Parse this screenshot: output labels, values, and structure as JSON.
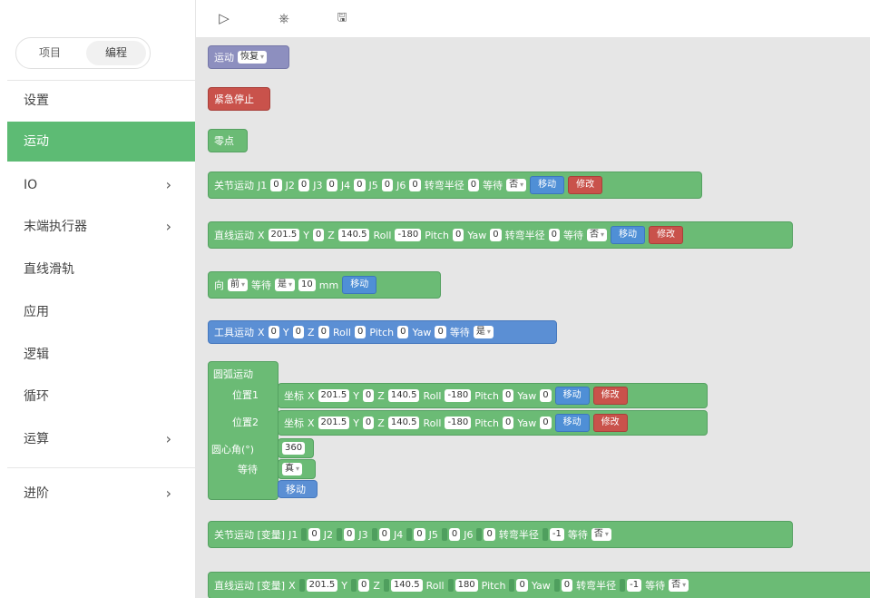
{
  "sidebar": {
    "seg": {
      "project": "项目",
      "program": "编程"
    },
    "items": [
      {
        "label": "设置"
      },
      {
        "label": "运动"
      },
      {
        "label": "IO",
        "arrow": "›"
      },
      {
        "label": "末端执行器",
        "arrow": "›"
      },
      {
        "label": "直线滑轨"
      },
      {
        "label": "应用"
      },
      {
        "label": "逻辑"
      },
      {
        "label": "循环"
      },
      {
        "label": "运算",
        "arrow": "›"
      },
      {
        "label": "进阶",
        "arrow": "›"
      }
    ]
  },
  "toolbar": {
    "run_icon": "▷",
    "debug_icon": "⎈",
    "save_icon": "🖫"
  },
  "blocks": {
    "b1": {
      "label": "运动",
      "dd": "恢复"
    },
    "b2": {
      "label": "紧急停止"
    },
    "b3": {
      "label": "零点"
    },
    "b4": {
      "label": "关节运动",
      "j1": "J1",
      "v1": "0",
      "j2": "J2",
      "v2": "0",
      "j3": "J3",
      "v3": "0",
      "j4": "J4",
      "v4": "0",
      "j5": "J5",
      "v5": "0",
      "j6": "J6",
      "v6": "0",
      "radius": "转弯半径",
      "rv": "0",
      "wait": "等待",
      "wv": "否",
      "move": "移动",
      "modify": "修改"
    },
    "b5": {
      "label": "直线运动",
      "x": "X",
      "xv": "201.5",
      "y": "Y",
      "yv": "0",
      "z": "Z",
      "zv": "140.5",
      "roll": "Roll",
      "rollv": "-180",
      "pitch": "Pitch",
      "pitchv": "0",
      "yaw": "Yaw",
      "yawv": "0",
      "radius": "转弯半径",
      "rv": "0",
      "wait": "等待",
      "wv": "否",
      "move": "移动",
      "modify": "修改"
    },
    "b6": {
      "label": "向",
      "dir": "前",
      "wait": "等待",
      "wv": "是",
      "dist": "10",
      "unit": "mm",
      "move": "移动"
    },
    "b7": {
      "label": "工具运动",
      "x": "X",
      "xv": "0",
      "y": "Y",
      "yv": "0",
      "z": "Z",
      "zv": "0",
      "roll": "Roll",
      "rollv": "0",
      "pitch": "Pitch",
      "pitchv": "0",
      "yaw": "Yaw",
      "yawv": "0",
      "wait": "等待",
      "wv": "是"
    },
    "b8": {
      "label": "圆弧运动",
      "pos1": "位置1",
      "pos2": "位置2",
      "coord": "坐标",
      "x": "X",
      "xv": "201.5",
      "y": "Y",
      "yv": "0",
      "z": "Z",
      "zv": "140.5",
      "roll": "Roll",
      "rollv": "-180",
      "pitch": "Pitch",
      "pitchv": "0",
      "yaw": "Yaw",
      "yawv": "0",
      "move": "移动",
      "modify": "修改",
      "angle": "圆心角(°)",
      "anglev": "360",
      "wait": "等待",
      "waitv": "真",
      "final_move": "移动"
    },
    "b9": {
      "label": "关节运动 [变量]",
      "j1": "J1",
      "v1": "0",
      "j2": "J2",
      "v2": "0",
      "j3": "J3",
      "v3": "0",
      "j4": "J4",
      "v4": "0",
      "j5": "J5",
      "v5": "0",
      "j6": "J6",
      "v6": "0",
      "radius": "转弯半径",
      "rv": "-1",
      "wait": "等待",
      "wv": "否"
    },
    "b10": {
      "label": "直线运动 [变量]",
      "x": "X",
      "xv": "201.5",
      "y": "Y",
      "yv": "0",
      "z": "Z",
      "zv": "140.5",
      "roll": "Roll",
      "rollv": "180",
      "pitch": "Pitch",
      "pitchv": "0",
      "yaw": "Yaw",
      "yawv": "0",
      "radius": "转弯半径",
      "rv": "-1",
      "wait": "等待",
      "wv": "否"
    }
  }
}
